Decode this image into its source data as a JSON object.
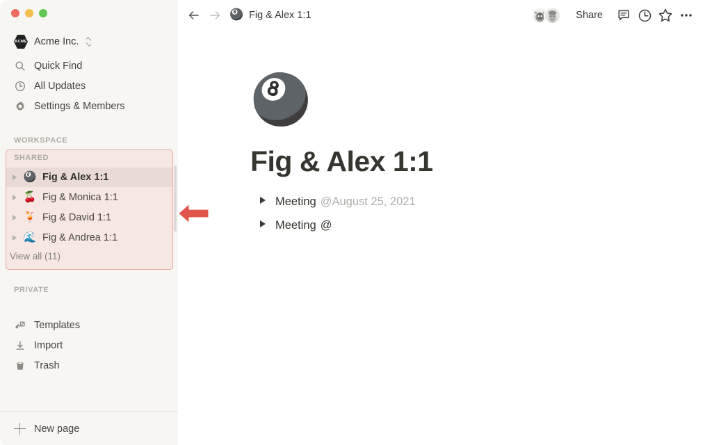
{
  "window": {
    "traffic_lights": [
      "close",
      "minimize",
      "maximize"
    ]
  },
  "sidebar": {
    "workspace": {
      "badge_text": "ACME",
      "name": "Acme Inc.",
      "switcher_icon": "chevron-up-down-icon"
    },
    "nav_items": [
      {
        "label": "Quick Find",
        "icon": "search-icon"
      },
      {
        "label": "All Updates",
        "icon": "clock-icon"
      },
      {
        "label": "Settings & Members",
        "icon": "gear-icon"
      }
    ],
    "workspace_label": "WORKSPACE",
    "shared": {
      "label": "SHARED",
      "highlighted": true,
      "highlight_color": "#e8a59f",
      "items": [
        {
          "emoji": "🎱",
          "label": "Fig & Alex 1:1",
          "selected": true
        },
        {
          "emoji": "🍒",
          "label": "Fig & Monica 1:1",
          "selected": false
        },
        {
          "emoji": "🍹",
          "label": "Fig & David 1:1",
          "selected": false
        },
        {
          "emoji": "🌊",
          "label": "Fig & Andrea 1:1",
          "selected": false
        }
      ],
      "view_all": "View all (11)"
    },
    "private_label": "PRIVATE",
    "private_items": [
      {
        "label": "Templates",
        "icon": "templates-icon"
      },
      {
        "label": "Import",
        "icon": "import-icon"
      },
      {
        "label": "Trash",
        "icon": "trash-icon"
      }
    ],
    "new_page": {
      "label": "New page",
      "icon": "plus-icon"
    }
  },
  "topbar": {
    "back_icon": "arrow-left-icon",
    "forward_icon": "arrow-right-icon",
    "breadcrumb_emoji": "🎱",
    "breadcrumb_title": "Fig & Alex 1:1",
    "avatars": [
      "collaborator-1",
      "collaborator-2"
    ],
    "share_label": "Share",
    "icons": [
      "comment-icon",
      "clock-history-icon",
      "star-icon",
      "more-options-icon"
    ]
  },
  "document": {
    "emoji": "🎱",
    "title": "Fig & Alex 1:1",
    "blocks": [
      {
        "type": "toggle",
        "text": "Meeting",
        "mention": "@August 25, 2021"
      },
      {
        "type": "toggle",
        "text": "Meeting",
        "mention": "@"
      }
    ]
  },
  "annotation": {
    "arrow_color": "#e2554a",
    "direction": "left",
    "points_at": "shared-section"
  }
}
